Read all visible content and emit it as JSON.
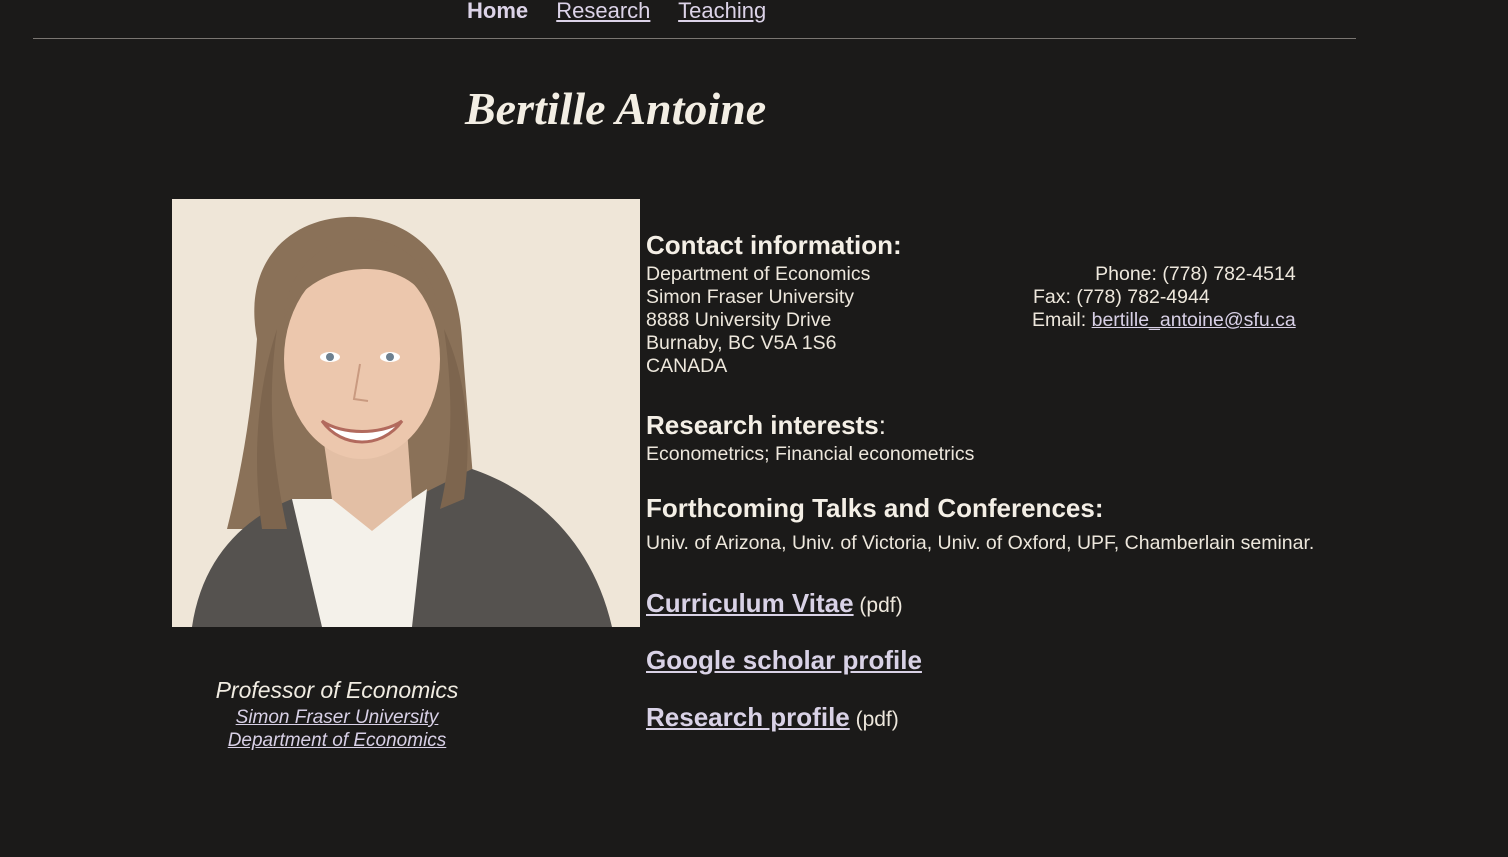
{
  "nav": {
    "home": "Home",
    "research": "Research",
    "teaching": "Teaching"
  },
  "header": {
    "name": "Bertille Antoine"
  },
  "caption": {
    "title": "Professor of Economics",
    "university_link": "Simon Fraser University",
    "department_link": "Department of Economics"
  },
  "contact": {
    "heading": "Contact information:",
    "address": [
      "Department of Economics",
      "Simon Fraser University",
      "8888 University Drive",
      "Burnaby, BC V5A 1S6",
      "CANADA"
    ],
    "phone": "Phone: (778) 782-4514",
    "fax": "Fax: (778) 782-4944",
    "email_label": "Email: ",
    "email": "bertille_antoine@sfu.ca"
  },
  "interests": {
    "heading": "Research interests",
    "colon": ":",
    "text": "Econometrics; Financial econometrics"
  },
  "talks": {
    "heading": "Forthcoming Talks and Conferences:",
    "text": "Univ. of Arizona, Univ. of Victoria, Univ. of Oxford, UPF, Chamberlain seminar."
  },
  "links": {
    "cv": "Curriculum Vitae",
    "cv_suffix": " (pdf)",
    "scholar": "Google scholar profile",
    "research_profile": "Research profile",
    "research_profile_suffix": " (pdf)"
  },
  "colors": {
    "background": "#1b1a19",
    "text": "#f0ebe0",
    "link": "#d8d0e6",
    "photo_background": "#efe6d8"
  }
}
